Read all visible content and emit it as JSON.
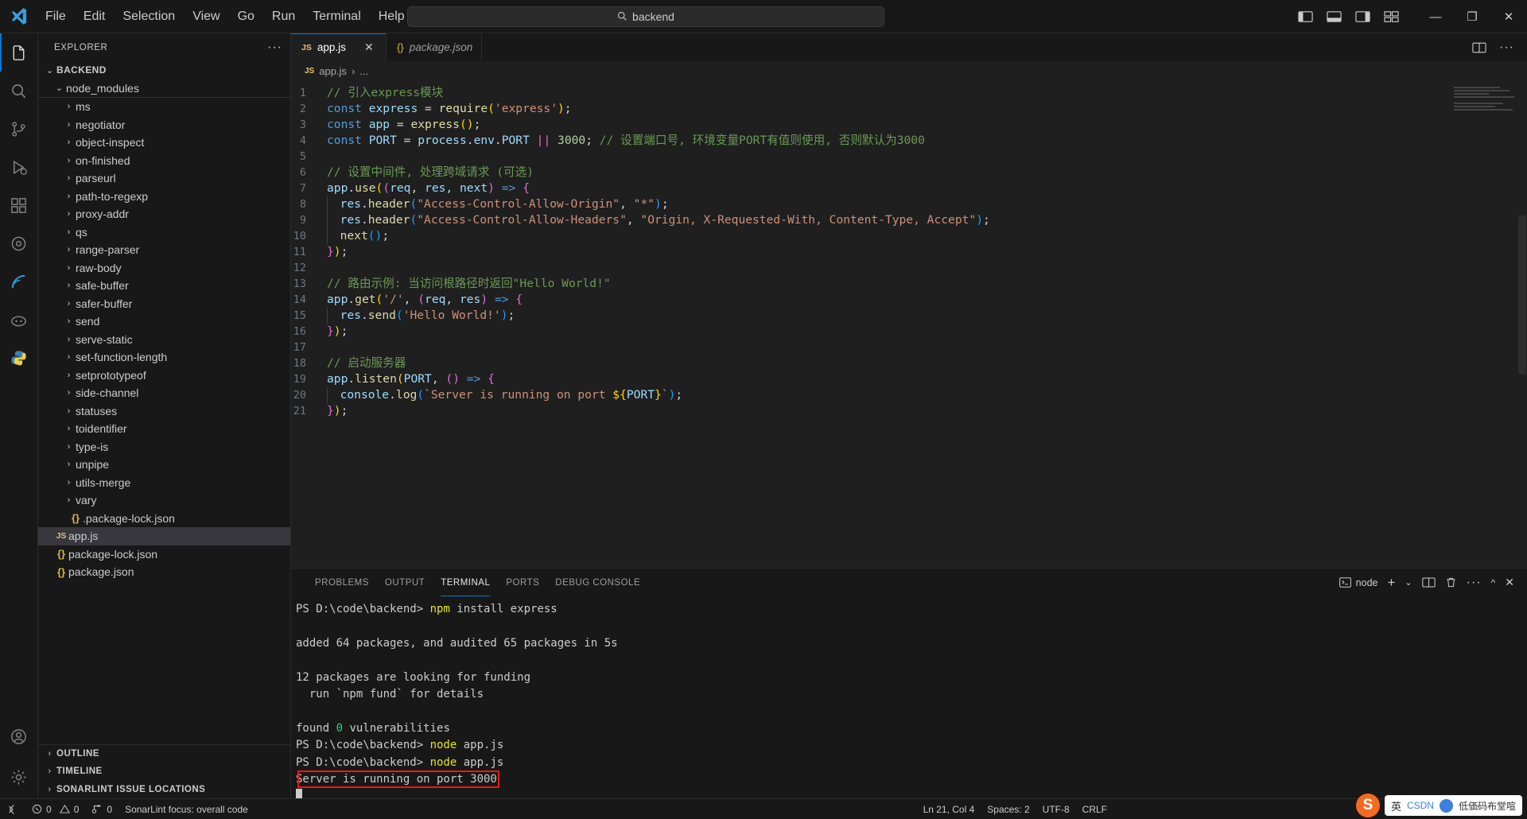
{
  "titlebar": {
    "menu": [
      "File",
      "Edit",
      "Selection",
      "View",
      "Go",
      "Run",
      "Terminal",
      "Help"
    ],
    "back_arrow": "←",
    "forward_arrow": "→",
    "search_value": "backend",
    "search_icon": "search-icon",
    "minimize": "—",
    "maximize": "❐",
    "close": "✕"
  },
  "activitybar": {
    "items": [
      {
        "name": "explorer",
        "glyph": "files"
      },
      {
        "name": "search",
        "glyph": "search"
      },
      {
        "name": "source-control",
        "glyph": "git"
      },
      {
        "name": "run-debug",
        "glyph": "debug"
      },
      {
        "name": "extensions",
        "glyph": "ext"
      },
      {
        "name": "settings-sync",
        "glyph": "gear-circle"
      },
      {
        "name": "sonarlint",
        "glyph": "sonar"
      },
      {
        "name": "copilot",
        "glyph": "copilot"
      },
      {
        "name": "python",
        "glyph": "python"
      }
    ],
    "bottom": [
      {
        "name": "accounts",
        "glyph": "account"
      },
      {
        "name": "manage",
        "glyph": "gear"
      }
    ]
  },
  "sidebar": {
    "title": "EXPLORER",
    "more_label": "···",
    "root": {
      "label": "BACKEND",
      "chevron": "⌄"
    },
    "node_modules": {
      "label": "node_modules",
      "chevron": "⌄"
    },
    "folders": [
      "ms",
      "negotiator",
      "object-inspect",
      "on-finished",
      "parseurl",
      "path-to-regexp",
      "proxy-addr",
      "qs",
      "range-parser",
      "raw-body",
      "safe-buffer",
      "safer-buffer",
      "send",
      "serve-static",
      "set-function-length",
      "setprototypeof",
      "side-channel",
      "statuses",
      "toidentifier",
      "type-is",
      "unpipe",
      "utils-merge",
      "vary"
    ],
    "files_in_nm": [
      {
        "name": ".package-lock.json",
        "icon": "json"
      }
    ],
    "files": [
      {
        "name": "app.js",
        "icon": "js",
        "selected": true
      },
      {
        "name": "package-lock.json",
        "icon": "json",
        "selected": false
      },
      {
        "name": "package.json",
        "icon": "json",
        "selected": false
      }
    ],
    "sections": [
      {
        "label": "OUTLINE",
        "chevron": "›"
      },
      {
        "label": "TIMELINE",
        "chevron": "›"
      },
      {
        "label": "SONARLINT ISSUE LOCATIONS",
        "chevron": "›"
      }
    ]
  },
  "editor": {
    "tabs": [
      {
        "label": "app.js",
        "icon": "JS",
        "icon_kind": "js",
        "active": true,
        "italic": false,
        "close": "✕"
      },
      {
        "label": "package.json",
        "icon": "{}",
        "icon_kind": "json",
        "active": false,
        "italic": true,
        "close": ""
      }
    ],
    "tab_actions": {
      "split_editor": "split-editor-icon",
      "more": "···"
    },
    "breadcrumb": {
      "icon": "JS",
      "file": "app.js",
      "sep": "›",
      "tail": "..."
    },
    "lines": [
      {
        "n": 1,
        "tokens": [
          {
            "t": "// 引入express模块",
            "c": "t-com"
          }
        ]
      },
      {
        "n": 2,
        "tokens": [
          {
            "t": "const",
            "c": "t-kw"
          },
          {
            "t": " ",
            "c": "t-op"
          },
          {
            "t": "express",
            "c": "t-var"
          },
          {
            "t": " = ",
            "c": "t-op"
          },
          {
            "t": "require",
            "c": "t-fn"
          },
          {
            "t": "(",
            "c": "t-p1"
          },
          {
            "t": "'express'",
            "c": "t-str"
          },
          {
            "t": ")",
            "c": "t-p1"
          },
          {
            "t": ";",
            "c": "t-op"
          }
        ]
      },
      {
        "n": 3,
        "tokens": [
          {
            "t": "const",
            "c": "t-kw"
          },
          {
            "t": " ",
            "c": "t-op"
          },
          {
            "t": "app",
            "c": "t-var"
          },
          {
            "t": " = ",
            "c": "t-op"
          },
          {
            "t": "express",
            "c": "t-fn"
          },
          {
            "t": "(",
            "c": "t-p1"
          },
          {
            "t": ")",
            "c": "t-p1"
          },
          {
            "t": ";",
            "c": "t-op"
          }
        ]
      },
      {
        "n": 4,
        "tokens": [
          {
            "t": "const",
            "c": "t-kw"
          },
          {
            "t": " ",
            "c": "t-op"
          },
          {
            "t": "PORT",
            "c": "t-var"
          },
          {
            "t": " = ",
            "c": "t-op"
          },
          {
            "t": "process",
            "c": "t-var"
          },
          {
            "t": ".",
            "c": "t-op"
          },
          {
            "t": "env",
            "c": "t-var"
          },
          {
            "t": ".",
            "c": "t-op"
          },
          {
            "t": "PORT",
            "c": "t-var"
          },
          {
            "t": " ",
            "c": "t-op"
          },
          {
            "t": "||",
            "c": "t-p2"
          },
          {
            "t": " ",
            "c": "t-op"
          },
          {
            "t": "3000",
            "c": "t-num"
          },
          {
            "t": "; ",
            "c": "t-op"
          },
          {
            "t": "// 设置端口号, 环境变量PORT有值则使用, 否则默认为3000",
            "c": "t-com"
          }
        ]
      },
      {
        "n": 5,
        "tokens": []
      },
      {
        "n": 6,
        "tokens": [
          {
            "t": "// 设置中间件, 处理跨域请求 (可选)",
            "c": "t-com"
          }
        ]
      },
      {
        "n": 7,
        "tokens": [
          {
            "t": "app",
            "c": "t-var"
          },
          {
            "t": ".",
            "c": "t-op"
          },
          {
            "t": "use",
            "c": "t-fn"
          },
          {
            "t": "(",
            "c": "t-p1"
          },
          {
            "t": "(",
            "c": "t-p2"
          },
          {
            "t": "req",
            "c": "t-var"
          },
          {
            "t": ", ",
            "c": "t-op"
          },
          {
            "t": "res",
            "c": "t-var"
          },
          {
            "t": ", ",
            "c": "t-op"
          },
          {
            "t": "next",
            "c": "t-var"
          },
          {
            "t": ")",
            "c": "t-p2"
          },
          {
            "t": " ",
            "c": "t-op"
          },
          {
            "t": "=>",
            "c": "t-kw"
          },
          {
            "t": " ",
            "c": "t-op"
          },
          {
            "t": "{",
            "c": "t-p2"
          }
        ]
      },
      {
        "n": 8,
        "indent": 1,
        "tokens": [
          {
            "t": "res",
            "c": "t-var"
          },
          {
            "t": ".",
            "c": "t-op"
          },
          {
            "t": "header",
            "c": "t-fn"
          },
          {
            "t": "(",
            "c": "t-p3"
          },
          {
            "t": "\"Access-Control-Allow-Origin\"",
            "c": "t-str"
          },
          {
            "t": ", ",
            "c": "t-op"
          },
          {
            "t": "\"*\"",
            "c": "t-str"
          },
          {
            "t": ")",
            "c": "t-p3"
          },
          {
            "t": ";",
            "c": "t-op"
          }
        ]
      },
      {
        "n": 9,
        "indent": 1,
        "tokens": [
          {
            "t": "res",
            "c": "t-var"
          },
          {
            "t": ".",
            "c": "t-op"
          },
          {
            "t": "header",
            "c": "t-fn"
          },
          {
            "t": "(",
            "c": "t-p3"
          },
          {
            "t": "\"Access-Control-Allow-Headers\"",
            "c": "t-str"
          },
          {
            "t": ", ",
            "c": "t-op"
          },
          {
            "t": "\"Origin, X-Requested-With, Content-Type, Accept\"",
            "c": "t-str"
          },
          {
            "t": ")",
            "c": "t-p3"
          },
          {
            "t": ";",
            "c": "t-op"
          }
        ]
      },
      {
        "n": 10,
        "indent": 1,
        "tokens": [
          {
            "t": "next",
            "c": "t-fn"
          },
          {
            "t": "(",
            "c": "t-p3"
          },
          {
            "t": ")",
            "c": "t-p3"
          },
          {
            "t": ";",
            "c": "t-op"
          }
        ]
      },
      {
        "n": 11,
        "tokens": [
          {
            "t": "}",
            "c": "t-p2"
          },
          {
            "t": ")",
            "c": "t-p1"
          },
          {
            "t": ";",
            "c": "t-op"
          }
        ]
      },
      {
        "n": 12,
        "tokens": []
      },
      {
        "n": 13,
        "tokens": [
          {
            "t": "// 路由示例: 当访问根路径时返回\"Hello World!\"",
            "c": "t-com"
          }
        ]
      },
      {
        "n": 14,
        "tokens": [
          {
            "t": "app",
            "c": "t-var"
          },
          {
            "t": ".",
            "c": "t-op"
          },
          {
            "t": "get",
            "c": "t-fn"
          },
          {
            "t": "(",
            "c": "t-p1"
          },
          {
            "t": "'/'",
            "c": "t-str"
          },
          {
            "t": ", ",
            "c": "t-op"
          },
          {
            "t": "(",
            "c": "t-p2"
          },
          {
            "t": "req",
            "c": "t-var"
          },
          {
            "t": ", ",
            "c": "t-op"
          },
          {
            "t": "res",
            "c": "t-var"
          },
          {
            "t": ")",
            "c": "t-p2"
          },
          {
            "t": " ",
            "c": "t-op"
          },
          {
            "t": "=>",
            "c": "t-kw"
          },
          {
            "t": " ",
            "c": "t-op"
          },
          {
            "t": "{",
            "c": "t-p2"
          }
        ]
      },
      {
        "n": 15,
        "indent": 1,
        "tokens": [
          {
            "t": "res",
            "c": "t-var"
          },
          {
            "t": ".",
            "c": "t-op"
          },
          {
            "t": "send",
            "c": "t-fn"
          },
          {
            "t": "(",
            "c": "t-p3"
          },
          {
            "t": "'Hello World!'",
            "c": "t-str"
          },
          {
            "t": ")",
            "c": "t-p3"
          },
          {
            "t": ";",
            "c": "t-op"
          }
        ]
      },
      {
        "n": 16,
        "tokens": [
          {
            "t": "}",
            "c": "t-p2"
          },
          {
            "t": ")",
            "c": "t-p1"
          },
          {
            "t": ";",
            "c": "t-op"
          }
        ]
      },
      {
        "n": 17,
        "tokens": []
      },
      {
        "n": 18,
        "tokens": [
          {
            "t": "// 启动服务器",
            "c": "t-com"
          }
        ]
      },
      {
        "n": 19,
        "tokens": [
          {
            "t": "app",
            "c": "t-var"
          },
          {
            "t": ".",
            "c": "t-op"
          },
          {
            "t": "listen",
            "c": "t-fn"
          },
          {
            "t": "(",
            "c": "t-p1"
          },
          {
            "t": "PORT",
            "c": "t-var"
          },
          {
            "t": ", ",
            "c": "t-op"
          },
          {
            "t": "(",
            "c": "t-p2"
          },
          {
            "t": ")",
            "c": "t-p2"
          },
          {
            "t": " ",
            "c": "t-op"
          },
          {
            "t": "=>",
            "c": "t-kw"
          },
          {
            "t": " ",
            "c": "t-op"
          },
          {
            "t": "{",
            "c": "t-p2"
          }
        ]
      },
      {
        "n": 20,
        "indent": 1,
        "tokens": [
          {
            "t": "console",
            "c": "t-var"
          },
          {
            "t": ".",
            "c": "t-op"
          },
          {
            "t": "log",
            "c": "t-fn"
          },
          {
            "t": "(",
            "c": "t-p3"
          },
          {
            "t": "`Server is running on port ",
            "c": "t-tpl"
          },
          {
            "t": "${",
            "c": "t-tplv"
          },
          {
            "t": "PORT",
            "c": "t-var"
          },
          {
            "t": "}",
            "c": "t-tplv"
          },
          {
            "t": "`",
            "c": "t-tpl"
          },
          {
            "t": ")",
            "c": "t-p3"
          },
          {
            "t": ";",
            "c": "t-op"
          }
        ]
      },
      {
        "n": 21,
        "tokens": [
          {
            "t": "}",
            "c": "t-p2"
          },
          {
            "t": ")",
            "c": "t-p1"
          },
          {
            "t": ";",
            "c": "t-op"
          }
        ]
      }
    ]
  },
  "panel": {
    "tabs": [
      {
        "label": "PROBLEMS",
        "active": false
      },
      {
        "label": "OUTPUT",
        "active": false
      },
      {
        "label": "TERMINAL",
        "active": true
      },
      {
        "label": "PORTS",
        "active": false
      },
      {
        "label": "DEBUG CONSOLE",
        "active": false
      }
    ],
    "shell_label": "node",
    "actions": {
      "new_terminal": "+",
      "dropdown": "⌄",
      "split": "split-terminal-icon",
      "kill": "trash-icon",
      "more": "···",
      "maximize": "^",
      "close": "✕"
    },
    "terminal_lines": [
      {
        "segments": [
          {
            "t": "PS D:\\code\\backend> ",
            "c": ""
          },
          {
            "t": "npm",
            "c": "y"
          },
          {
            "t": " install express",
            "c": ""
          }
        ]
      },
      {
        "segments": []
      },
      {
        "segments": [
          {
            "t": "added 64 packages, and audited 65 packages in 5s",
            "c": ""
          }
        ]
      },
      {
        "segments": []
      },
      {
        "segments": [
          {
            "t": "12 packages are looking for funding",
            "c": ""
          }
        ]
      },
      {
        "segments": [
          {
            "t": "  run `npm fund` for details",
            "c": ""
          }
        ]
      },
      {
        "segments": []
      },
      {
        "segments": [
          {
            "t": "found ",
            "c": ""
          },
          {
            "t": "0",
            "c": "g"
          },
          {
            "t": " vulnerabilities",
            "c": ""
          }
        ]
      },
      {
        "segments": [
          {
            "t": "PS D:\\code\\backend> ",
            "c": ""
          },
          {
            "t": "node",
            "c": "y"
          },
          {
            "t": " app.js",
            "c": ""
          }
        ]
      },
      {
        "segments": [
          {
            "t": "PS D:\\code\\backend> ",
            "c": ""
          },
          {
            "t": "node",
            "c": "y"
          },
          {
            "t": " app.js",
            "c": ""
          }
        ]
      },
      {
        "segments": [
          {
            "t": "Server is running on port 3000",
            "c": ""
          }
        ],
        "highlight": true
      }
    ],
    "highlight_color": "#f11616"
  },
  "statusbar": {
    "remote_icon": "remote-icon",
    "errors": "0",
    "warnings": "0",
    "ports": "0",
    "sonarlint": "SonarLint focus: overall code",
    "cursor": "Ln 21, Col 4",
    "spaces": "Spaces: 2",
    "encoding": "UTF-8",
    "eol": "CRLF"
  },
  "ime": {
    "logo": "S",
    "lang": "英",
    "items": [
      "CSDN",
      "低価码布堂喧"
    ]
  }
}
